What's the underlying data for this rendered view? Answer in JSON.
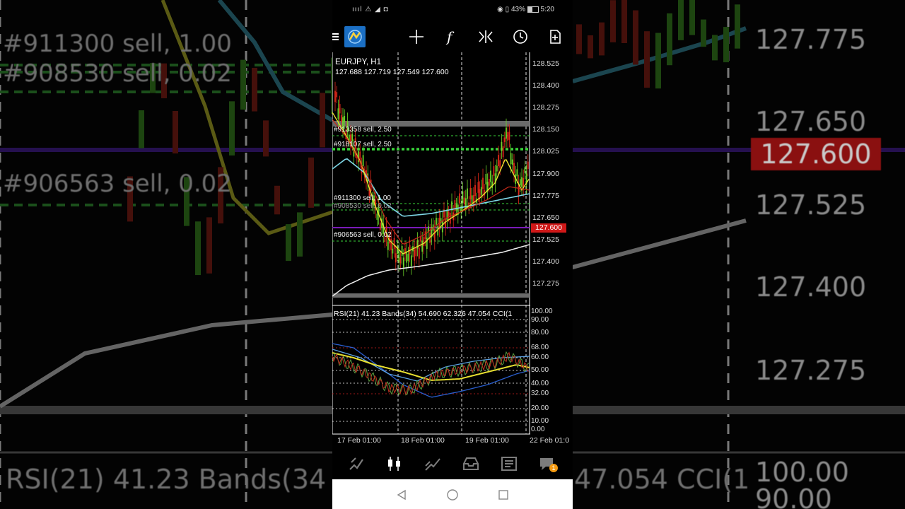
{
  "status_bar": {
    "left": "ıııl ⚠ ◢ ◘",
    "battery": "43%",
    "time": "5:20"
  },
  "chart": {
    "symbol": "EURJPY, H1",
    "ohlc": "127.688 127.719 127.549 127.600",
    "current_price": "127.600",
    "price_ticks": [
      "128.525",
      "128.400",
      "128.275",
      "128.150",
      "128.025",
      "127.900",
      "127.775",
      "127.650",
      "127.525",
      "127.400",
      "127.275"
    ],
    "indicator_header": "RSI(21) 41.23 Bands(34) 54.690 62.326 47.054 CCI(1",
    "indicator_ticks": [
      "100.00",
      "90.00",
      "80.00",
      "68.00",
      "60.00",
      "50.00",
      "40.00",
      "32.00",
      "20.00",
      "10.00",
      "0.00"
    ],
    "dates": [
      "17 Feb 01:00",
      "18 Feb 01:00",
      "19 Feb 01:00",
      "22 Feb 01:0"
    ],
    "orders": [
      "#913358 sell, 2.50",
      "#918107 sell, 2.50",
      "#911300 sell, 1.00",
      "#908530 sell, 0.02",
      "#906563 sell, 0.02"
    ]
  },
  "background": {
    "orders": [
      "#911300 sell, 1.00",
      "#908530 sell, 0.02",
      "#906563 sell, 0.02"
    ],
    "prices": [
      "127.775",
      "127.650",
      "127.525",
      "127.400",
      "127.275"
    ],
    "current_price": "127.600",
    "indicator_header_left": "RSI(21) 41.23 Bands(34",
    "indicator_header_right": "47.054 CCI(1",
    "indicator_ticks": [
      "100.00",
      "90.00"
    ]
  },
  "bottom_nav": {
    "chat_badge": "1"
  },
  "colors": {
    "bull": "#6cd42a",
    "bear": "#e0281a",
    "ma_yellow": "#e8e030",
    "ma_cyan": "#7fd8e8",
    "ma_red": "#c82a1a",
    "ma_white": "#f0f0f0",
    "order_line": "#3ad43a",
    "price_line": "#7a1ab8"
  }
}
